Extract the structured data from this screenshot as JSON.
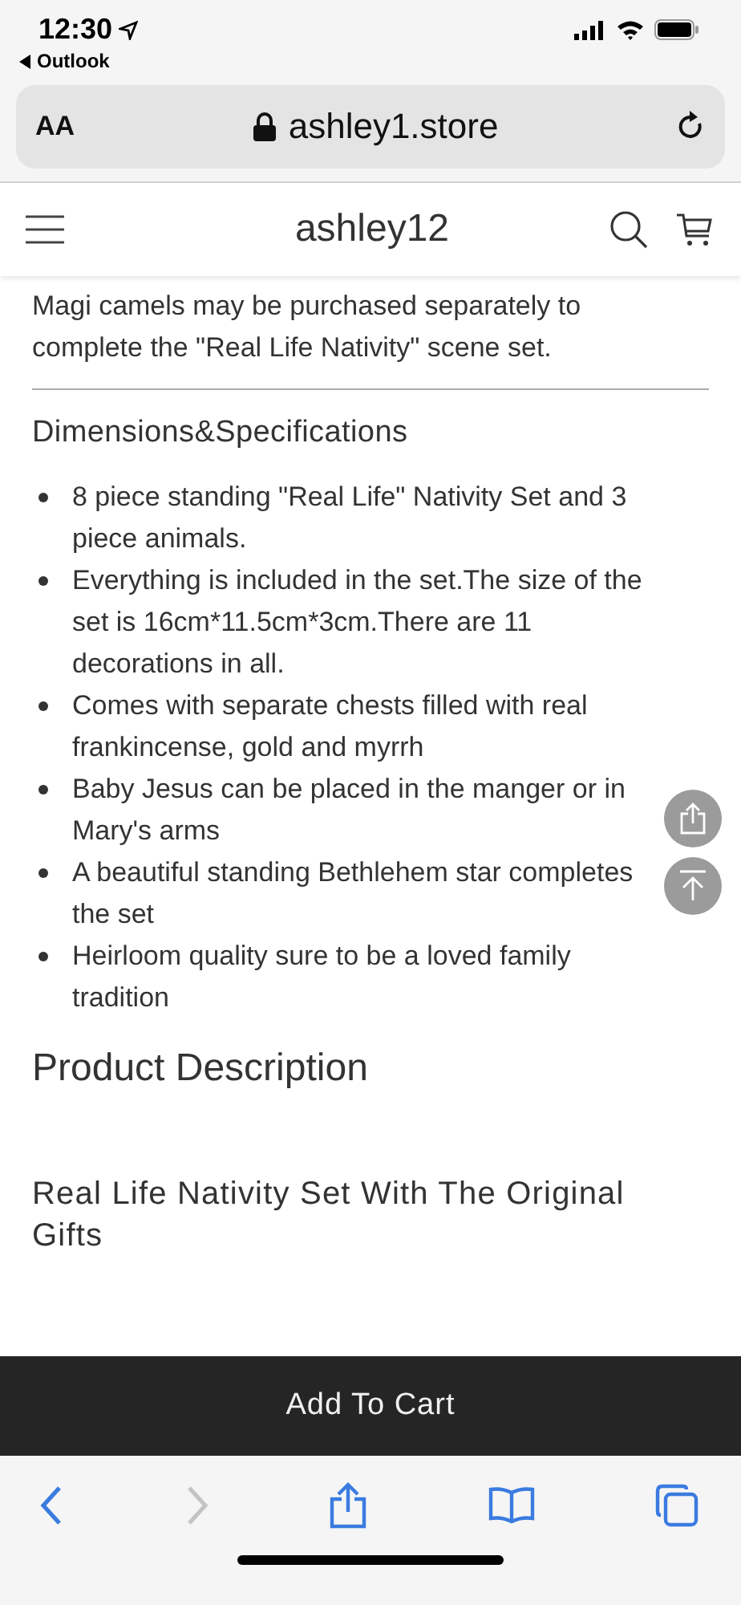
{
  "status_bar": {
    "time": "12:30",
    "back_app": "Outlook"
  },
  "address_bar": {
    "text_size": "AA",
    "url": "ashley1.store"
  },
  "header": {
    "store_name": "ashley12"
  },
  "intro_lines": [
    "Magi camels may be purchased separately to complete the \"Real Life Nativity\" scene set."
  ],
  "specs": {
    "title": "Dimensions&Specifications",
    "items": [
      "8 piece standing \"Real Life\" Nativity Set and 3 piece  animals.",
      "Everything is included in the set.The size of the set is 16cm*11.5cm*3cm.There are 11 decorations in all.",
      "Comes with separate chests filled with real frankincense, gold and myrrh",
      "Baby Jesus can be placed in the manger or in Mary's arms",
      "A beautiful standing Bethlehem star completes the set",
      "Heirloom quality sure to be a loved family tradition"
    ]
  },
  "description": {
    "title": "Product Description",
    "subtitle": "Real Life Nativity Set With The Original Gifts"
  },
  "add_to_cart": "Add To Cart",
  "toolbar": [
    {
      "kind": "back",
      "disabled": false
    },
    {
      "kind": "forward",
      "disabled": true
    },
    {
      "kind": "share",
      "disabled": false
    },
    {
      "kind": "bookmarks",
      "disabled": false
    },
    {
      "kind": "tabs",
      "disabled": false
    }
  ]
}
